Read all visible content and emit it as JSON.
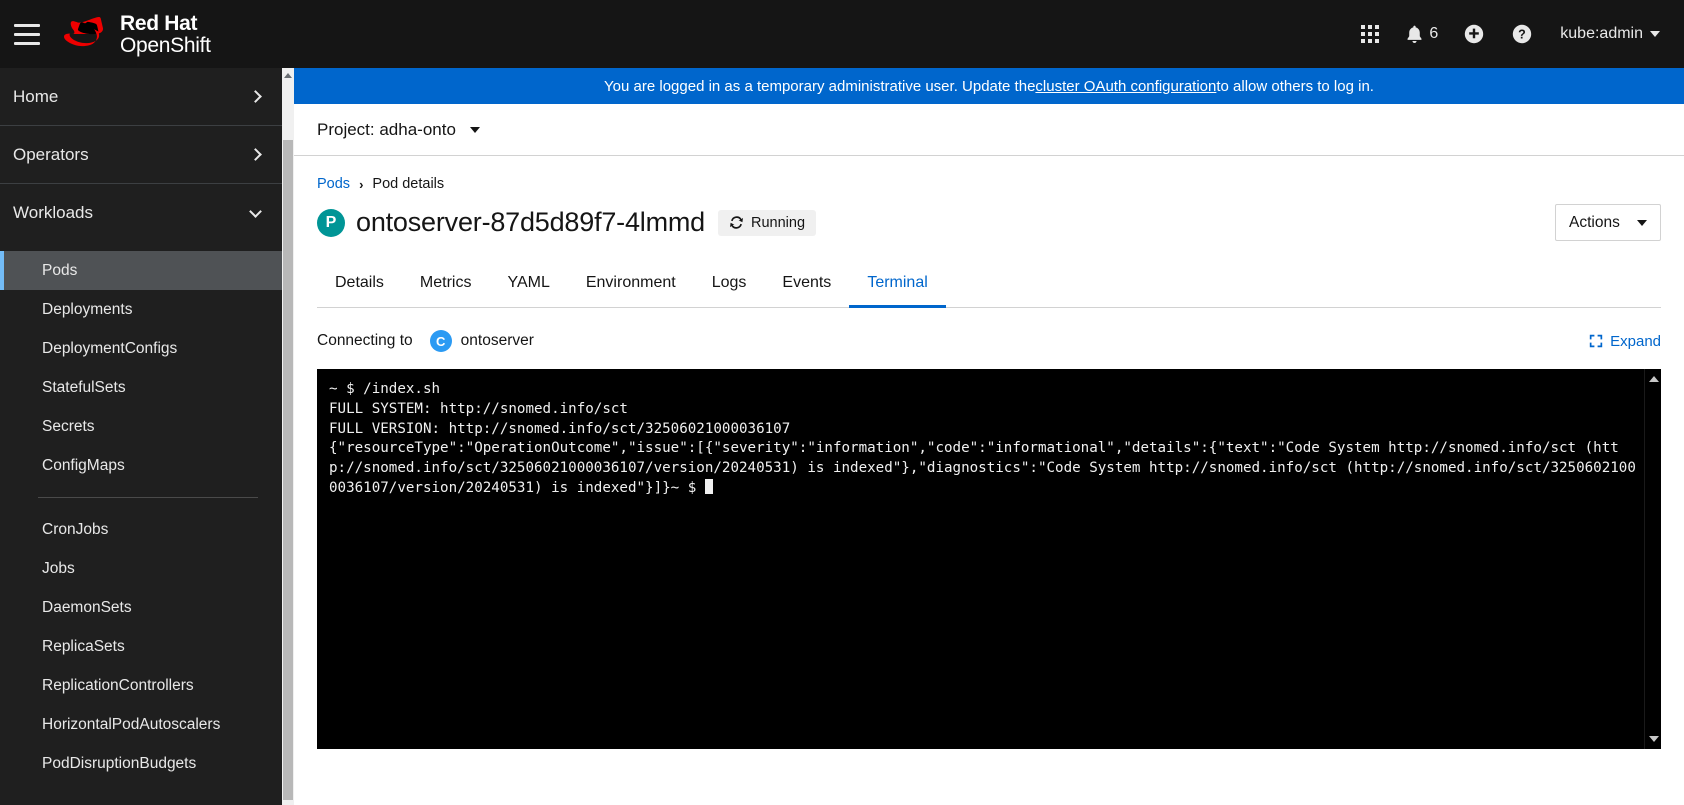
{
  "masthead": {
    "hamburger_label": "Navigation menu",
    "brand_line1": "Red Hat",
    "brand_line2": "OpenShift",
    "app_launcher_icon": "grid-icon",
    "notifications_icon": "bell-icon",
    "notifications_count": "6",
    "quick_create_icon": "plus-circle-icon",
    "help_icon": "question-circle-icon",
    "user_label": "kube:admin"
  },
  "sidebar": {
    "sections": [
      {
        "label": "Home",
        "chevron": "right",
        "expanded": false
      },
      {
        "label": "Operators",
        "chevron": "right",
        "expanded": false
      },
      {
        "label": "Workloads",
        "chevron": "down",
        "expanded": true
      }
    ],
    "items_group1": [
      {
        "label": "Pods",
        "active": true
      },
      {
        "label": "Deployments",
        "active": false
      },
      {
        "label": "DeploymentConfigs",
        "active": false
      },
      {
        "label": "StatefulSets",
        "active": false
      },
      {
        "label": "Secrets",
        "active": false
      },
      {
        "label": "ConfigMaps",
        "active": false
      }
    ],
    "items_group2": [
      {
        "label": "CronJobs",
        "active": false
      },
      {
        "label": "Jobs",
        "active": false
      },
      {
        "label": "DaemonSets",
        "active": false
      },
      {
        "label": "ReplicaSets",
        "active": false
      },
      {
        "label": "ReplicationControllers",
        "active": false
      },
      {
        "label": "HorizontalPodAutoscalers",
        "active": false
      },
      {
        "label": "PodDisruptionBudgets",
        "active": false
      }
    ]
  },
  "alert": {
    "text_before": "You are logged in as a temporary administrative user. Update the ",
    "link_text": "cluster OAuth configuration",
    "text_after": " to allow others to log in.",
    "background": "#0066cc"
  },
  "project": {
    "label": "Project: adha-onto"
  },
  "breadcrumb": {
    "parent": "Pods",
    "separator": "›",
    "current": "Pod details"
  },
  "page": {
    "resource_initial": "P",
    "resource_icon_color": "#009596",
    "title": "ontoserver-87d5d89f7-4lmmd",
    "status": "Running",
    "status_icon": "sync-icon",
    "actions_label": "Actions"
  },
  "tabs": [
    {
      "label": "Details",
      "active": false
    },
    {
      "label": "Metrics",
      "active": false
    },
    {
      "label": "YAML",
      "active": false
    },
    {
      "label": "Environment",
      "active": false
    },
    {
      "label": "Logs",
      "active": false
    },
    {
      "label": "Events",
      "active": false
    },
    {
      "label": "Terminal",
      "active": true
    }
  ],
  "terminal_header": {
    "connecting_label": "Connecting to",
    "container_initial": "C",
    "container_icon_color": "#2b9af3",
    "container_name": "ontoserver",
    "expand_label": "Expand",
    "expand_icon": "expand-icon"
  },
  "terminal": {
    "content": "~ $ /index.sh\nFULL SYSTEM: http://snomed.info/sct\nFULL VERSION: http://snomed.info/sct/32506021000036107\n{\"resourceType\":\"OperationOutcome\",\"issue\":[{\"severity\":\"information\",\"code\":\"informational\",\"details\":{\"text\":\"Code System http://snomed.info/sct (http://snomed.info/sct/32506021000036107/version/20240531) is indexed\"},\"diagnostics\":\"Code System http://snomed.info/sct (http://snomed.info/sct/32506021000036107/version/20240531) is indexed\"}]}~ $ ",
    "background": "#000000",
    "foreground": "#f0f0f0"
  }
}
